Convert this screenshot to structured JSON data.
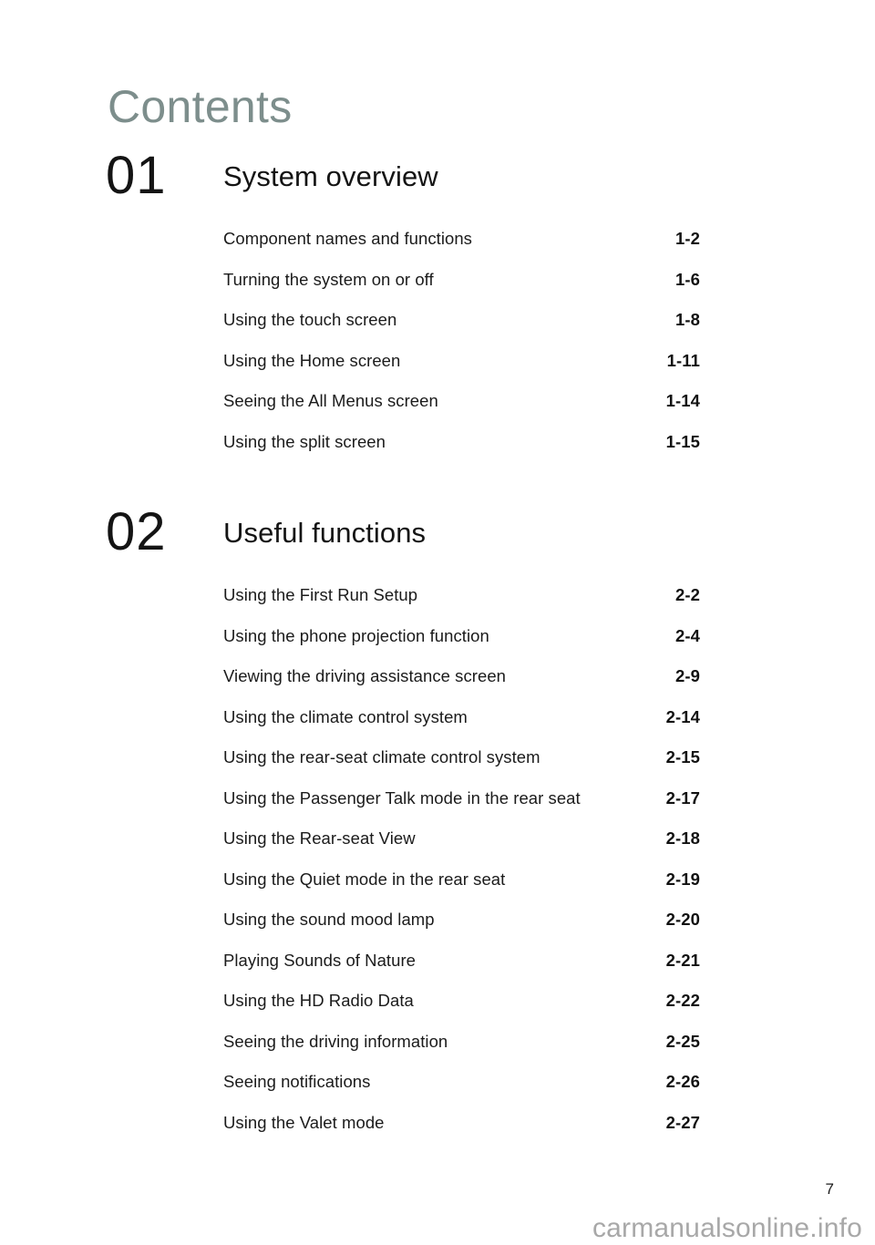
{
  "document": {
    "title": "Contents",
    "title_color": "#7d8e8c",
    "folio": "7",
    "watermark": "carmanualsonline.info"
  },
  "chapters": [
    {
      "number": "01",
      "title": "System overview",
      "entries": [
        {
          "label": "Component names and functions",
          "page": "1-2"
        },
        {
          "label": "Turning the system on or off",
          "page": "1-6"
        },
        {
          "label": "Using the touch screen",
          "page": "1-8"
        },
        {
          "label": "Using the Home screen",
          "page": "1-11"
        },
        {
          "label": "Seeing the All Menus screen",
          "page": "1-14"
        },
        {
          "label": "Using the split screen",
          "page": "1-15"
        }
      ]
    },
    {
      "number": "02",
      "title": "Useful functions",
      "entries": [
        {
          "label": "Using the First Run Setup",
          "page": "2-2"
        },
        {
          "label": "Using the phone projection function",
          "page": "2-4"
        },
        {
          "label": "Viewing the driving assistance screen",
          "page": "2-9"
        },
        {
          "label": "Using the climate control system",
          "page": "2-14"
        },
        {
          "label": "Using the rear-seat climate control system",
          "page": "2-15"
        },
        {
          "label": "Using the Passenger Talk mode in the rear seat",
          "page": "2-17"
        },
        {
          "label": "Using the Rear-seat View",
          "page": "2-18"
        },
        {
          "label": "Using the Quiet mode in the rear seat",
          "page": "2-19"
        },
        {
          "label": "Using the sound mood lamp",
          "page": "2-20"
        },
        {
          "label": "Playing Sounds of Nature",
          "page": "2-21"
        },
        {
          "label": "Using the HD Radio Data",
          "page": "2-22"
        },
        {
          "label": "Seeing the driving information",
          "page": "2-25"
        },
        {
          "label": "Seeing notifications",
          "page": "2-26"
        },
        {
          "label": "Using the Valet mode",
          "page": "2-27"
        }
      ]
    }
  ]
}
